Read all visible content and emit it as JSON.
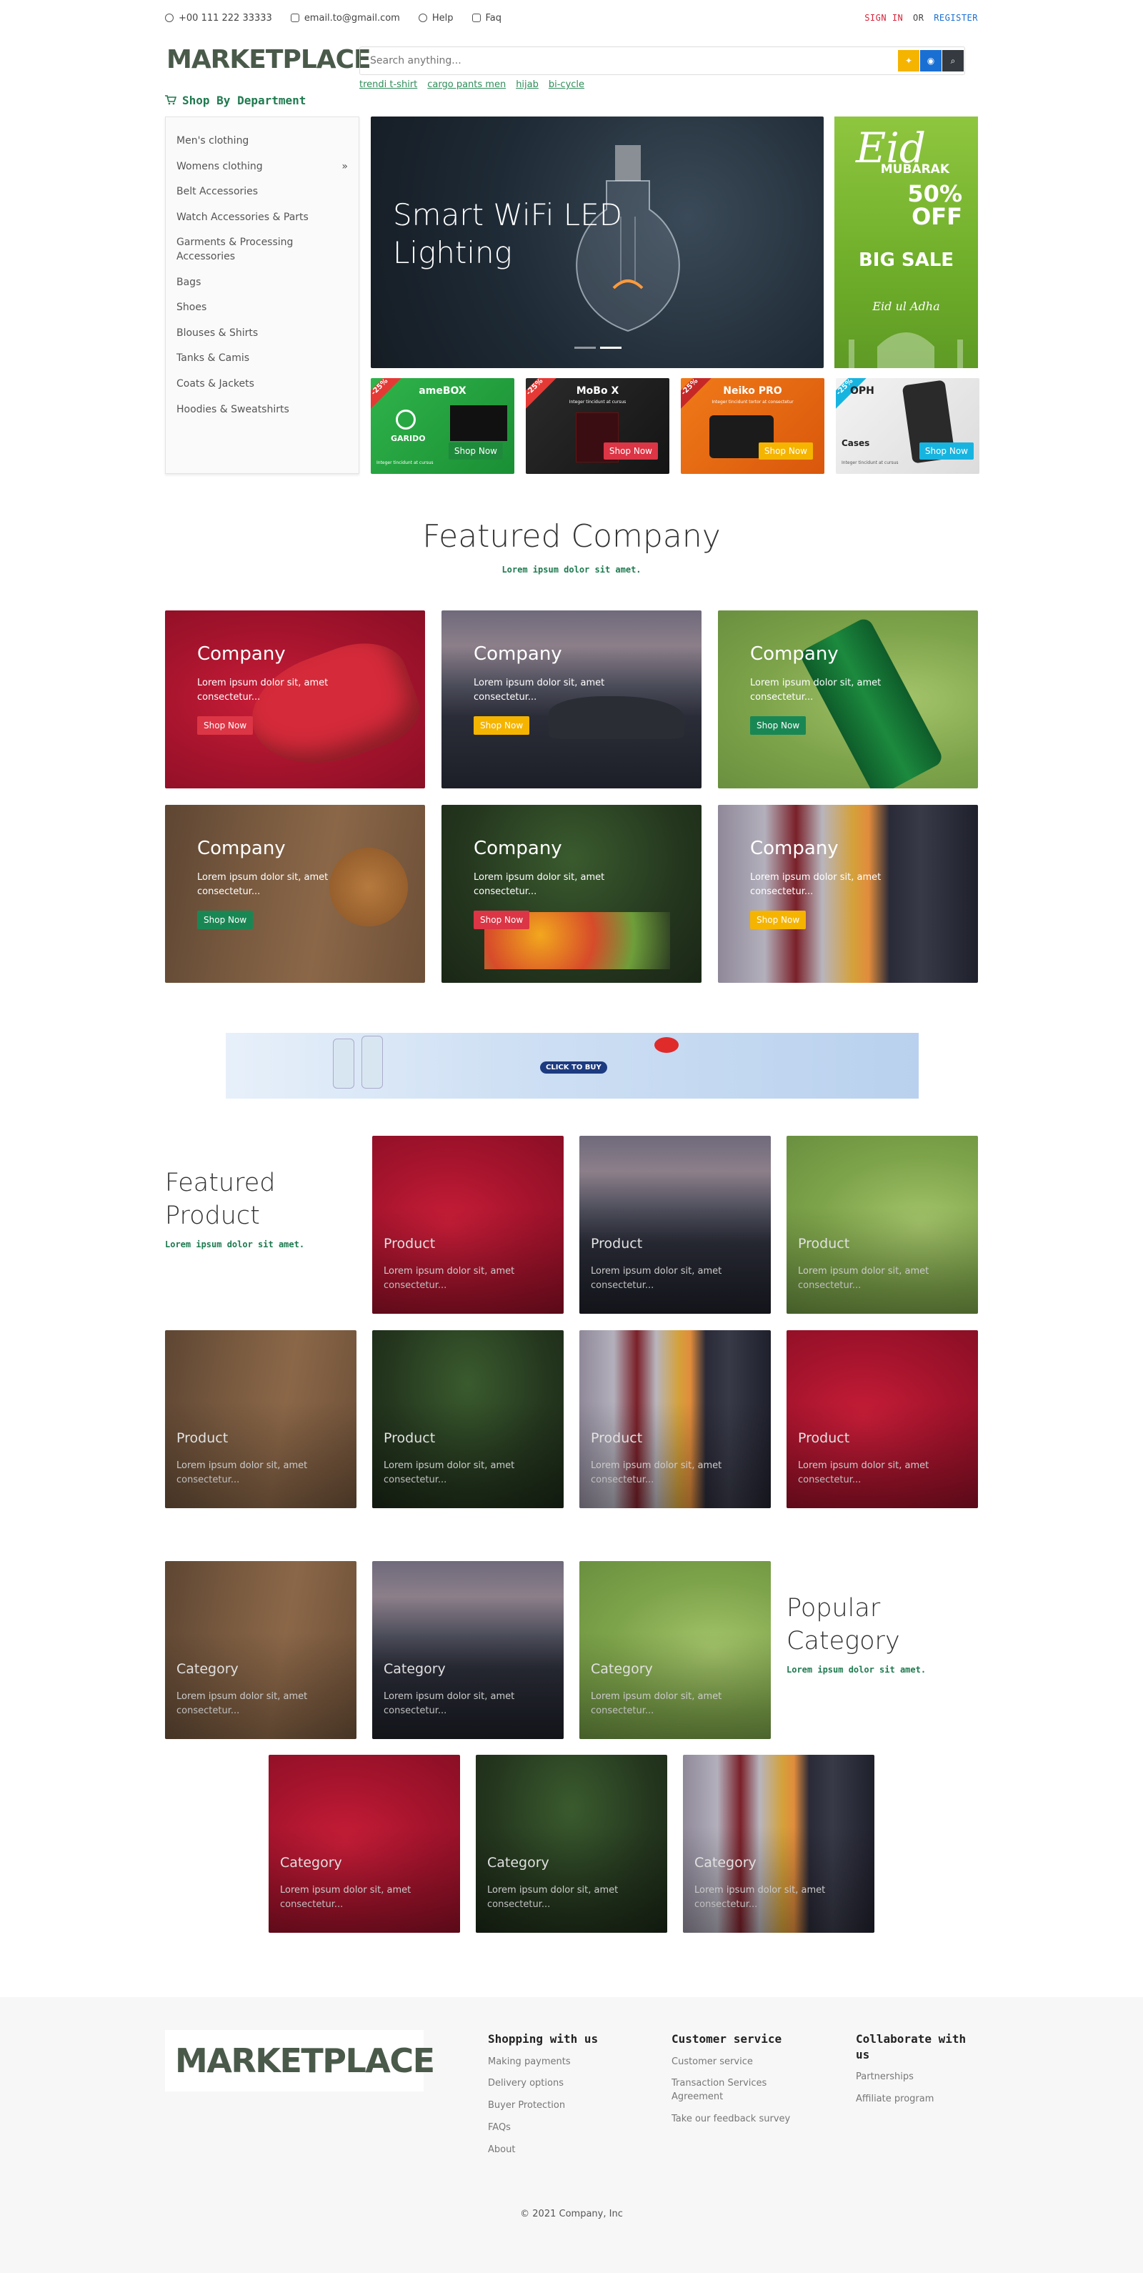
{
  "topbar": {
    "phone": "+00 111 222 33333",
    "email": "email.to@gmail.com",
    "help": "Help",
    "faq": "Faq",
    "signin": "SIGN IN",
    "or": "OR",
    "register": "REGISTER"
  },
  "brand": {
    "logo_text": "MARKETPLACE"
  },
  "search": {
    "placeholder": "Search anything...",
    "suggestions": [
      "trendi t-shirt",
      "cargo pants men",
      "hijab",
      "bi-cycle"
    ]
  },
  "department": {
    "title": "Shop By Department",
    "items": [
      "Men's clothing",
      "Womens clothing",
      "Belt Accessories",
      "Watch Accessories & Parts",
      "Garments & Processing Accessories",
      "Bags",
      "Shoes",
      "Blouses & Shirts",
      "Tanks & Camis",
      "Coats & Jackets",
      "Hoodies & Sweatshirts"
    ],
    "submenu_marker": "»"
  },
  "hero": {
    "line1": "Smart WiFi LED",
    "line2": "Lighting",
    "slide_count": 2,
    "active_slide": 2
  },
  "eid_banner": {
    "script": "Eid",
    "mubarak": "MUBARAK",
    "discount": "50%",
    "off": "OFF",
    "big_sale": "BIG SALE",
    "footer": "Eid ul Adha"
  },
  "promos": [
    {
      "ribbon": "-25%",
      "title": "ameBOX",
      "sub": "Integer tincidunt at cursus",
      "brand": "GARIDO",
      "button": "Shop Now"
    },
    {
      "ribbon": "-25%",
      "title": "MoBo X",
      "sub": "Integer tincidunt at cursus",
      "brand": "",
      "button": "Shop Now"
    },
    {
      "ribbon": "-25%",
      "title": "Neiko PRO",
      "sub": "Integer tincidunt tortor at consectetur",
      "brand": "",
      "button": "Shop Now"
    },
    {
      "ribbon": "-25%",
      "title": "OPH",
      "sub": "Integer tincidunt at cursus",
      "brand": "Cases",
      "button": "Shop Now"
    }
  ],
  "featured_company": {
    "title": "Featured Company",
    "subtitle": "Lorem ipsum dolor sit amet.",
    "cards": [
      {
        "title": "Company",
        "desc": "Lorem ipsum dolor sit, amet consectetur...",
        "button": "Shop Now",
        "btn_color": "#dc3545"
      },
      {
        "title": "Company",
        "desc": "Lorem ipsum dolor sit, amet consectetur...",
        "button": "Shop Now",
        "btn_color": "#f5b400"
      },
      {
        "title": "Company",
        "desc": "Lorem ipsum dolor sit, amet consectetur...",
        "button": "Shop Now",
        "btn_color": "#198754"
      },
      {
        "title": "Company",
        "desc": "Lorem ipsum dolor sit, amet consectetur...",
        "button": "Shop Now",
        "btn_color": "#198754"
      },
      {
        "title": "Company",
        "desc": "Lorem ipsum dolor sit, amet consectetur...",
        "button": "Shop Now",
        "btn_color": "#dc3545"
      },
      {
        "title": "Company",
        "desc": "Lorem ipsum dolor sit, amet consectetur...",
        "button": "Shop Now",
        "btn_color": "#f5b400"
      }
    ]
  },
  "ad_banner": {
    "cta": "CLICK TO BUY"
  },
  "featured_product": {
    "title_line1": "Featured",
    "title_line2": "Product",
    "subtitle": "Lorem ipsum dolor sit amet.",
    "items": [
      {
        "title": "Product",
        "desc": "Lorem ipsum dolor sit, amet consectetur..."
      },
      {
        "title": "Product",
        "desc": "Lorem ipsum dolor sit, amet consectetur..."
      },
      {
        "title": "Product",
        "desc": "Lorem ipsum dolor sit, amet consectetur..."
      },
      {
        "title": "Product",
        "desc": "Lorem ipsum dolor sit, amet consectetur..."
      },
      {
        "title": "Product",
        "desc": "Lorem ipsum dolor sit, amet consectetur..."
      },
      {
        "title": "Product",
        "desc": "Lorem ipsum dolor sit, amet consectetur..."
      },
      {
        "title": "Product",
        "desc": "Lorem ipsum dolor sit, amet consectetur..."
      }
    ]
  },
  "popular_category": {
    "title_line1": "Popular",
    "title_line2": "Category",
    "subtitle": "Lorem ipsum dolor sit amet.",
    "items": [
      {
        "title": "Category",
        "desc": "Lorem ipsum dolor sit, amet consectetur..."
      },
      {
        "title": "Category",
        "desc": "Lorem ipsum dolor sit, amet consectetur..."
      },
      {
        "title": "Category",
        "desc": "Lorem ipsum dolor sit, amet consectetur..."
      },
      {
        "title": "Category",
        "desc": "Lorem ipsum dolor sit, amet consectetur..."
      },
      {
        "title": "Category",
        "desc": "Lorem ipsum dolor sit, amet consectetur..."
      },
      {
        "title": "Category",
        "desc": "Lorem ipsum dolor sit, amet consectetur..."
      }
    ]
  },
  "footer": {
    "logo_text": "MARKETPLACE",
    "shopping": {
      "title": "Shopping with us",
      "links": [
        "Making payments",
        "Delivery options",
        "Buyer Protection",
        "FAQs",
        "About"
      ]
    },
    "service": {
      "title": "Customer service",
      "links": [
        "Customer service",
        "Transaction Services Agreement",
        "Take our feedback survey"
      ]
    },
    "collab": {
      "title": "Collaborate with us",
      "links": [
        "Partnerships",
        "Affiliate program"
      ]
    },
    "copyright": "© 2021 Company, Inc"
  },
  "colors": {
    "accent_green": "#1e7a4f",
    "signin_red": "#d9233a",
    "register_blue": "#1a6fd3",
    "search_yellow": "#f5b400",
    "search_blue": "#1a6fd3",
    "search_dark": "#343a40"
  }
}
